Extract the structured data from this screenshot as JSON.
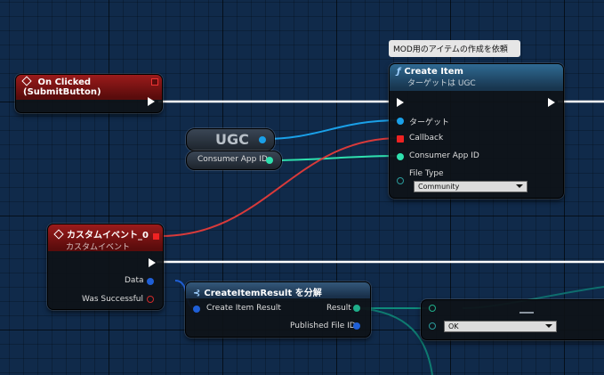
{
  "nodes": {
    "on_clicked": {
      "title": "On Clicked (SubmitButton)"
    },
    "create_item": {
      "tooltip": "MOD用のアイテムの作成を依頼",
      "title": "Create Item",
      "subtitle": "ターゲットは UGC",
      "inputs": {
        "target": "ターゲット",
        "callback": "Callback",
        "consumer_app_id": "Consumer App ID",
        "file_type": "File Type"
      },
      "file_type_value": "Community"
    },
    "ugc": {
      "label": "UGC"
    },
    "consumer_app_id": {
      "label": "Consumer App ID"
    },
    "custom_event": {
      "title": "カスタムイベント_0",
      "subtitle": "カスタムイベント",
      "outputs": {
        "data": "Data",
        "was_successful": "Was Successful"
      }
    },
    "break_result": {
      "title": "CreateItemResult を分解",
      "input": "Create Item Result",
      "outputs": {
        "result": "Result",
        "published_file_id": "Published File ID"
      }
    },
    "partial": {
      "dropdown_value": "OK"
    }
  },
  "colors": {
    "exec_wire": "#ffffff",
    "object_wire": "#1aa0e8",
    "delegate_wire": "#d83a3a",
    "struct_wire": "#2fe0ae",
    "enum_wire": "#0e6e6e"
  }
}
